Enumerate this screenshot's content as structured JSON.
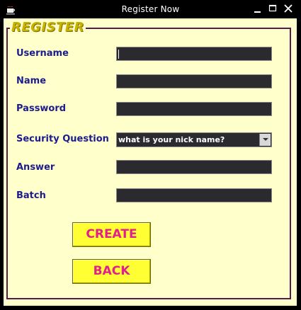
{
  "window": {
    "title": "Register Now"
  },
  "form": {
    "group_title": "REGISTER",
    "fields": [
      {
        "label": "Username",
        "value": ""
      },
      {
        "label": "Name",
        "value": ""
      },
      {
        "label": "Password",
        "value": ""
      },
      {
        "label": "Security Question",
        "value": "what is your nick name?"
      },
      {
        "label": "Answer",
        "value": ""
      },
      {
        "label": "Batch",
        "value": ""
      }
    ]
  },
  "buttons": {
    "create_label": "CREATE",
    "back_label": "BACK"
  },
  "colors": {
    "background": "#ffffcc",
    "label": "#1c1c8c",
    "field": "#2b2b2f",
    "button": "#ffff33",
    "button_text": "#e0208c",
    "group_title": "#c8b400"
  },
  "icons": {
    "app": "coffee-cup-icon",
    "minimize": "minimize-icon",
    "maximize": "maximize-icon",
    "close": "close-icon",
    "dropdown": "chevron-down-icon"
  }
}
